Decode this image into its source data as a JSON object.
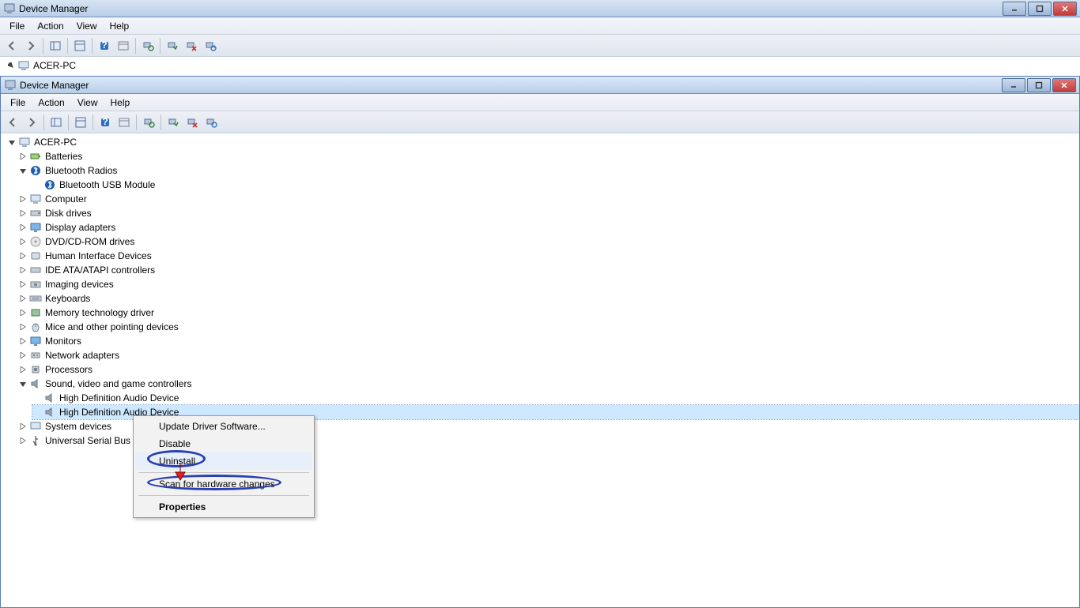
{
  "outer_window": {
    "title": "Device Manager",
    "menus": {
      "file": "File",
      "action": "Action",
      "view": "View",
      "help": "Help"
    },
    "root_node": "ACER-PC"
  },
  "inner_window": {
    "title": "Device Manager",
    "menus": {
      "file": "File",
      "action": "Action",
      "view": "View",
      "help": "Help"
    },
    "root_node": "ACER-PC",
    "tree": {
      "batteries": "Batteries",
      "bluetooth_radios": "Bluetooth Radios",
      "bluetooth_usb": "Bluetooth USB Module",
      "computer": "Computer",
      "disk_drives": "Disk drives",
      "display_adapters": "Display adapters",
      "dvd": "DVD/CD-ROM drives",
      "hid": "Human Interface Devices",
      "ide": "IDE ATA/ATAPI controllers",
      "imaging": "Imaging devices",
      "keyboards": "Keyboards",
      "memtech": "Memory technology driver",
      "mice": "Mice and other pointing devices",
      "monitors": "Monitors",
      "network": "Network adapters",
      "processors": "Processors",
      "sound": "Sound, video and game controllers",
      "hda1": "High Definition Audio Device",
      "hda2": "High Definition Audio Device",
      "system_devices": "System devices",
      "usb": "Universal Serial Bus"
    }
  },
  "context_menu": {
    "update": "Update Driver Software...",
    "disable": "Disable",
    "uninstall": "Uninstall",
    "scan": "Scan for hardware changes",
    "properties": "Properties"
  }
}
